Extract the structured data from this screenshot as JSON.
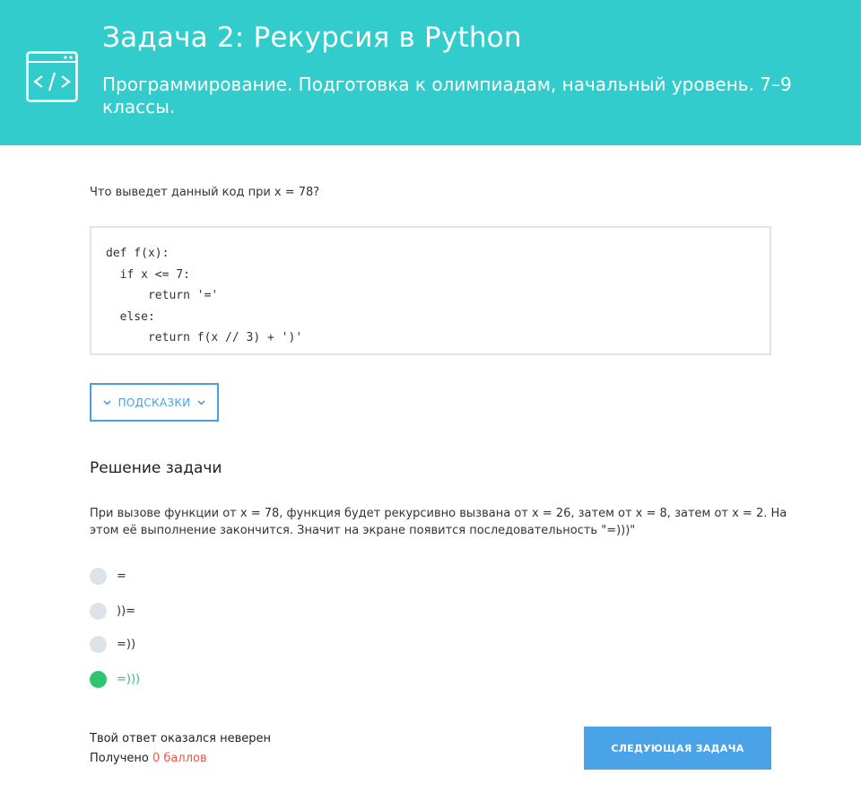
{
  "header": {
    "title": "Задача 2: Рекурсия в Python",
    "subtitle": "Программирование. Подготовка к олимпиадам, начальный уровень. 7–9 классы.",
    "icon": "code-window-icon"
  },
  "task": {
    "question": "Что выведет данный код при x = 78?",
    "code_lines": [
      "def f(x):",
      "  if x <= 7:",
      "      return '='",
      "  else:",
      "      return f(x // 3) + ')'"
    ]
  },
  "hints": {
    "label": "ПОДСКАЗКИ",
    "icon": "chevron-down-icon"
  },
  "solution": {
    "title": "Решение задачи",
    "text": "При вызове функции от x = 78, функция будет рекурсивно вызвана от x = 26, затем от x = 8, затем от x = 2. На этом её выполнение закончится. Значит на экране появится последовательность \"=)))\""
  },
  "options": [
    {
      "label": "=",
      "selected": false
    },
    {
      "label": "))=",
      "selected": false
    },
    {
      "label": "=))",
      "selected": false
    },
    {
      "label": "=)))",
      "selected": true
    }
  ],
  "result": {
    "message": "Твой ответ оказался неверен",
    "score_prefix": "Получено",
    "score_value": "0 баллов"
  },
  "next_button": {
    "label": "СЛЕДУЮЩАЯ ЗАДАЧА"
  },
  "colors": {
    "header": "#33cccc",
    "accent_blue": "#4aa3e6",
    "correct_green": "#2fc46f",
    "score_red": "#ee5544"
  }
}
